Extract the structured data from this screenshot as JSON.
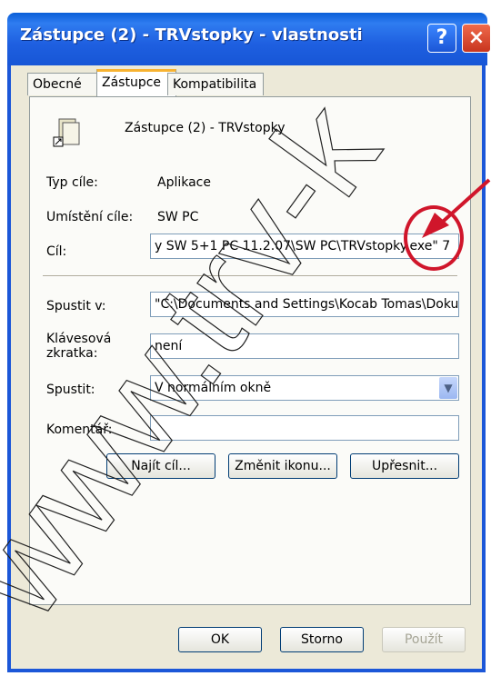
{
  "window": {
    "title": "Zástupce (2) - TRVstopky - vlastnosti"
  },
  "tabs": [
    "Obecné",
    "Zástupce",
    "Kompatibilita"
  ],
  "shortcut": {
    "name": "Zástupce (2) - TRVstopky"
  },
  "fields": {
    "type_label": "Typ cíle:",
    "type_value": "Aplikace",
    "location_label": "Umístění cíle:",
    "location_value": "SW PC",
    "target_label": "Cíl:",
    "target_value": "y SW 5+1 PC 11.2.07\\SW PC\\TRVstopky.exe\" 7",
    "startin_label": "Spustit v:",
    "startin_value": "\"C:\\Documents and Settings\\Kocab Tomas\\Doku",
    "hotkey_label": "Klávesová\nzkratka:",
    "hotkey_value": "není",
    "run_label": "Spustit:",
    "run_value": "V normálním okně",
    "comment_label": "Komentář:",
    "comment_value": ""
  },
  "buttons": {
    "find": "Najít cíl...",
    "change_icon": "Změnit ikonu...",
    "advanced": "Upřesnit...",
    "ok": "OK",
    "cancel": "Storno",
    "apply": "Použít"
  },
  "watermark": "www.trv-k",
  "colors": {
    "title_blue": "#1c57d8",
    "annotation_red": "#d0162b",
    "tab_orange": "#f8b331"
  }
}
